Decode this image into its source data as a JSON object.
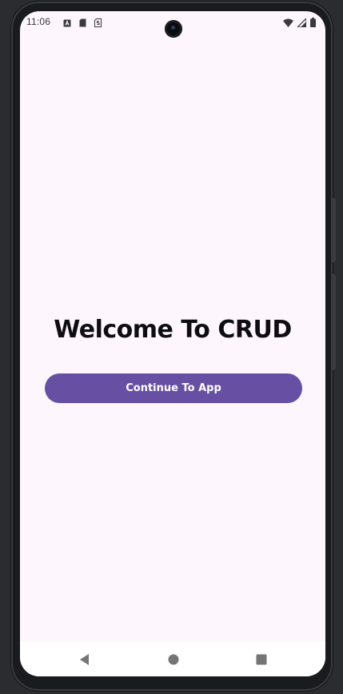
{
  "status_bar": {
    "time": "11:06",
    "left_icons": [
      "notification-a-icon",
      "sd-card-icon",
      "sim-icon"
    ],
    "right_icons": [
      "wifi-icon",
      "signal-icon",
      "battery-icon"
    ]
  },
  "main": {
    "title": "Welcome To CRUD",
    "continue_button_label": "Continue To App"
  },
  "nav_bar": {
    "buttons": [
      "back-icon",
      "home-icon",
      "recents-icon"
    ]
  },
  "colors": {
    "background": "#fdf7fd",
    "button": "#6750a4",
    "button_text": "#ffffff",
    "title": "#0e0e10"
  }
}
